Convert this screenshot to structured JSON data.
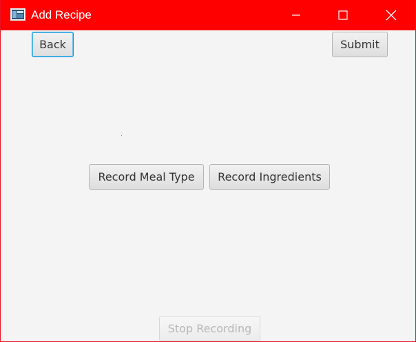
{
  "window": {
    "title": "Add Recipe",
    "titlebar_color": "#ff0000",
    "icons": {
      "app": "app-window-icon",
      "minimize": "minimize-icon",
      "maximize": "maximize-icon",
      "close": "close-icon"
    }
  },
  "toolbar": {
    "back_label": "Back",
    "submit_label": "Submit"
  },
  "recording": {
    "meal_type_label": "Record Meal Type",
    "ingredients_label": "Record Ingredients",
    "stop_label": "Stop Recording",
    "stop_enabled": false
  }
}
